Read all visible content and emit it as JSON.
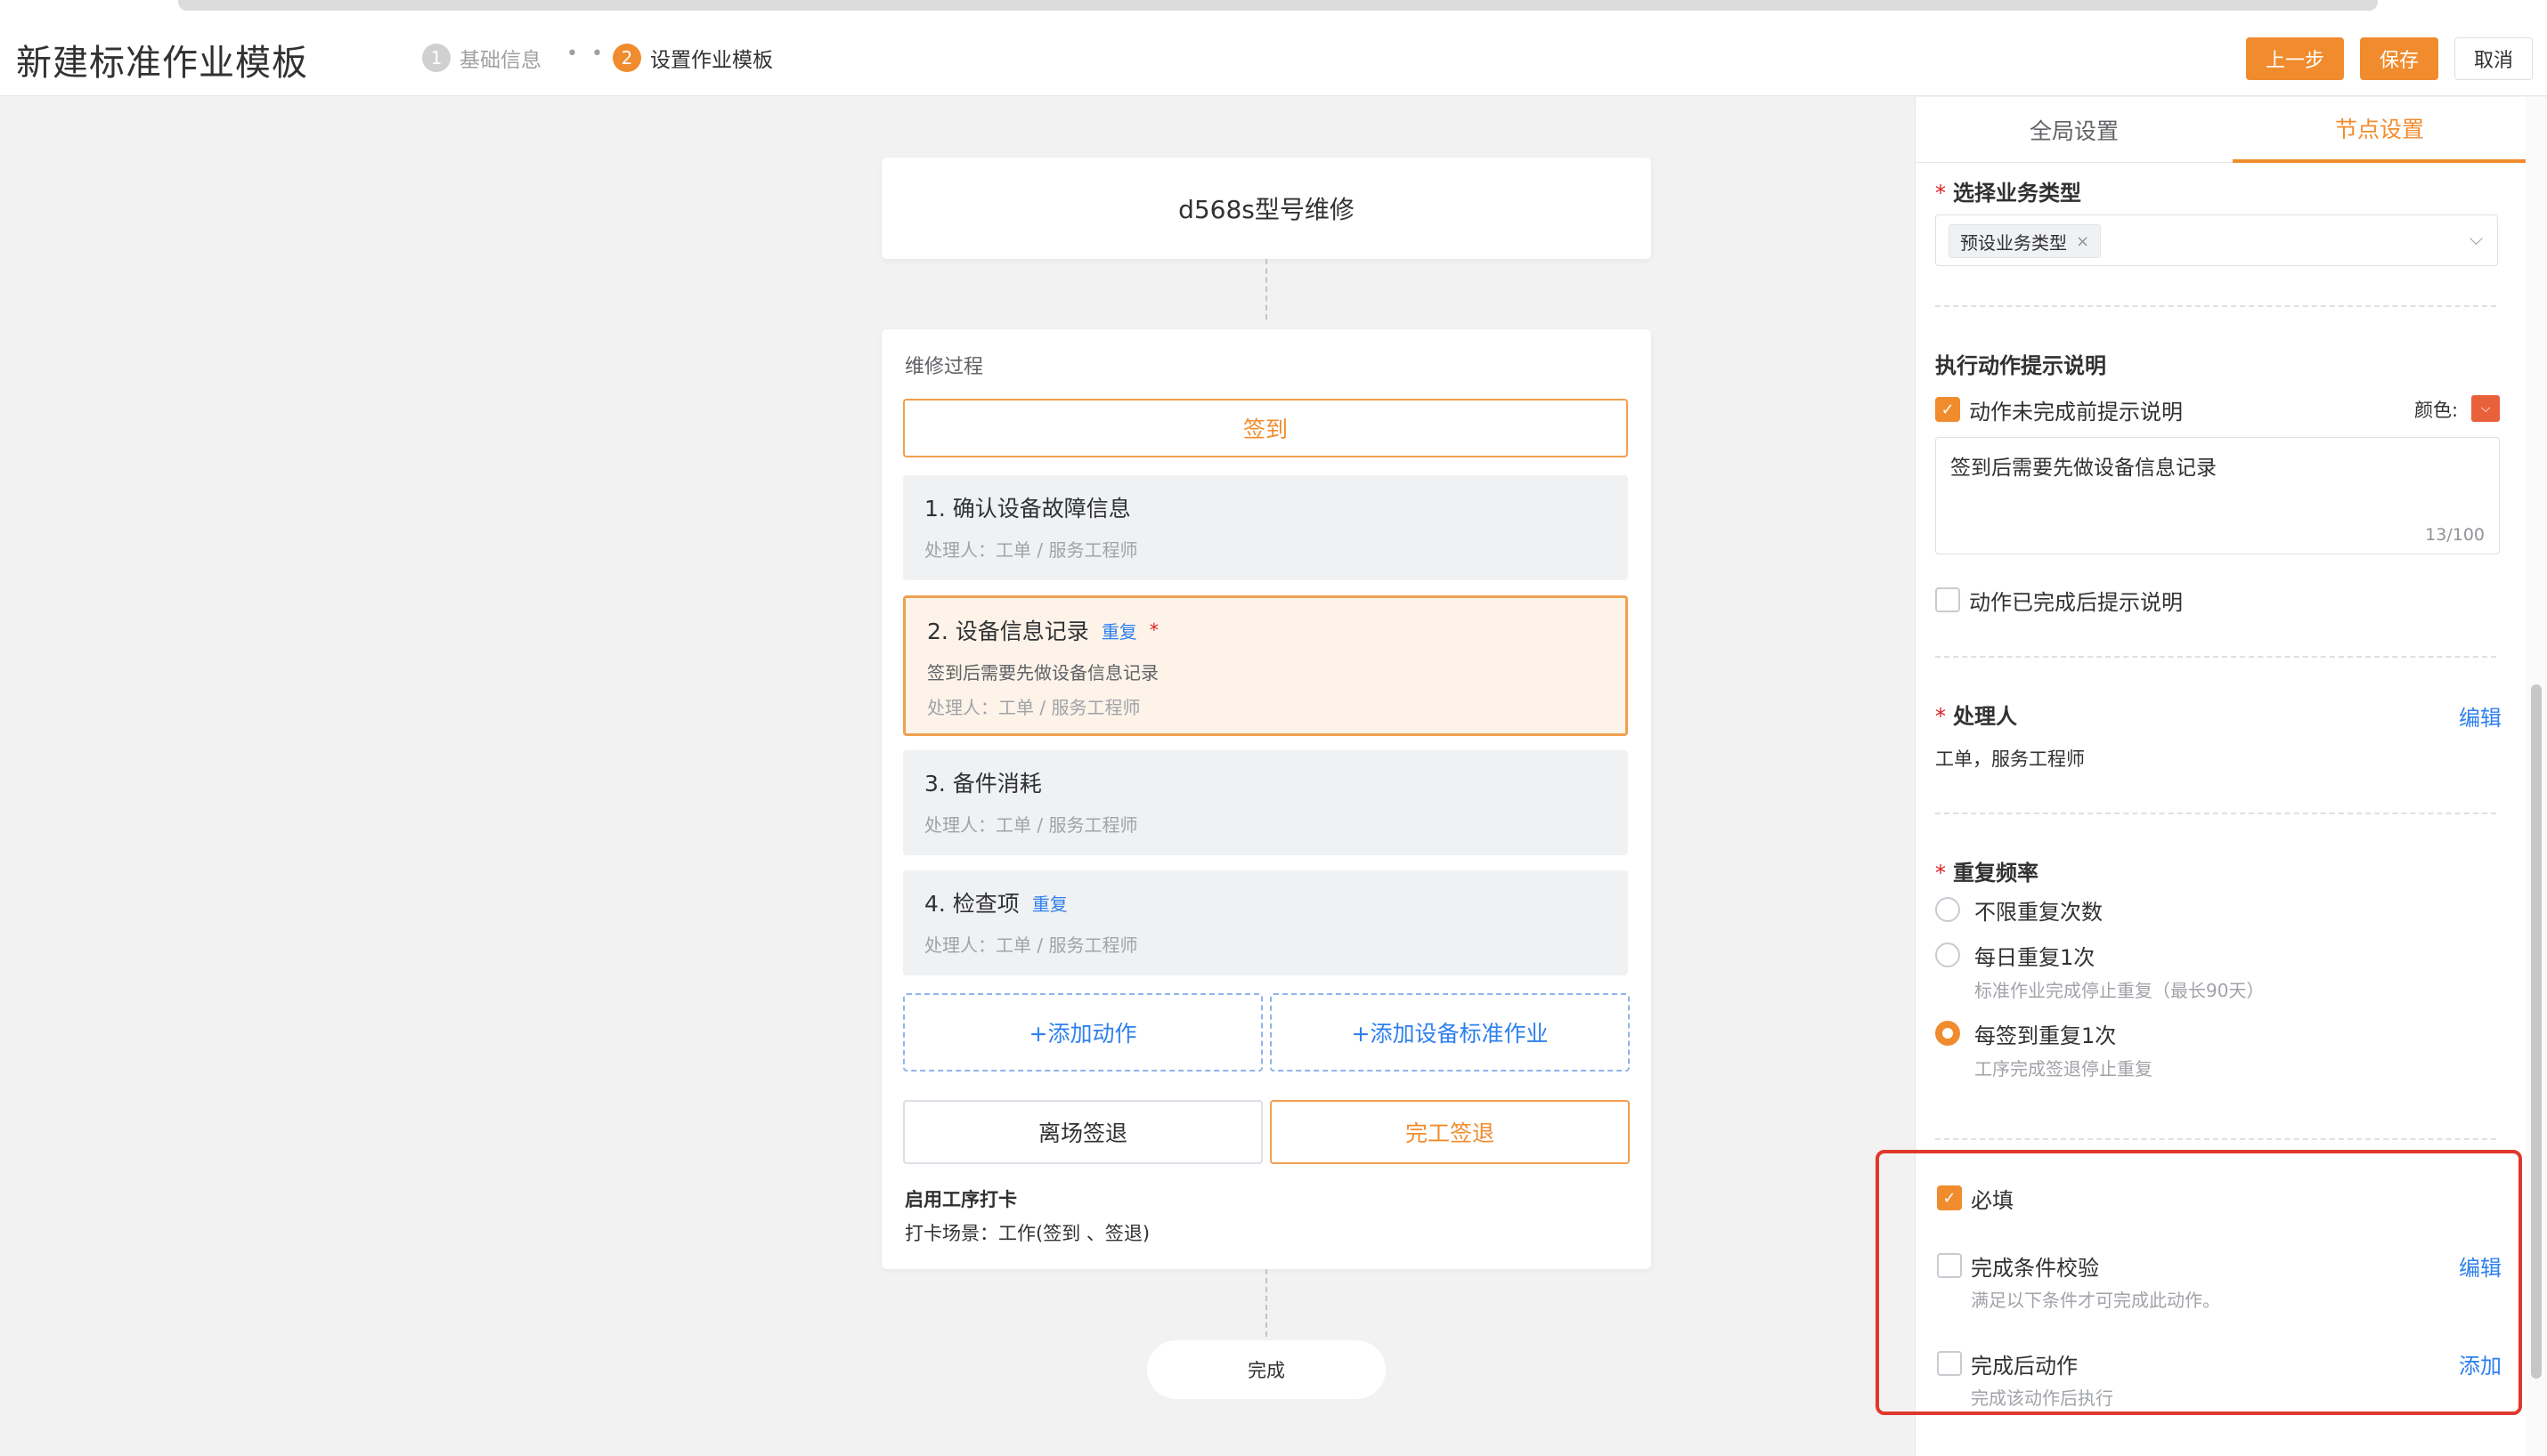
{
  "header": {
    "title": "新建标准作业模板",
    "steps": [
      {
        "num": "1",
        "label": "基础信息"
      },
      {
        "num": "2",
        "label": "设置作业模板"
      }
    ],
    "step_sep": "• •",
    "prev_label": "上一步",
    "save_label": "保存",
    "cancel_label": "取消"
  },
  "canvas": {
    "template_name": "d568s型号维修",
    "process_label": "维修过程",
    "checkin_label": "签到",
    "actions": [
      {
        "title": "1. 确认设备故障信息",
        "handler": "处理人：工单 / 服务工程师"
      },
      {
        "title": "2. 设备信息记录",
        "repeat": "重复",
        "required": "*",
        "desc": "签到后需要先做设备信息记录",
        "handler": "处理人：工单 / 服务工程师"
      },
      {
        "title": "3. 备件消耗",
        "handler": "处理人：工单 / 服务工程师"
      },
      {
        "title": "4. 检查项",
        "repeat": "重复",
        "handler": "处理人：工单 / 服务工程师"
      }
    ],
    "add_action": "+添加动作",
    "add_std": "+添加设备标准作业",
    "leave_checkout": "离场签退",
    "finish_checkout": "完工签退",
    "clock_title": "启用工序打卡",
    "clock_scene": "打卡场景：工作(签到 、签退)",
    "done_label": "完成"
  },
  "panel": {
    "tabs": [
      "全局设置",
      "节点设置"
    ],
    "biz_type_label": "选择业务类型",
    "biz_type_tag": "预设业务类型",
    "tag_close": "×",
    "select_chevron": "⌵",
    "tip_section": "执行动作提示说明",
    "tip_before_label": "动作未完成前提示说明",
    "color_label": "颜色:",
    "color_value": "#e8613b",
    "tip_before_text": "签到后需要先做设备信息记录",
    "tip_count": "13/100",
    "tip_after_label": "动作已完成后提示说明",
    "handler_label": "处理人",
    "handler_edit": "编辑",
    "handler_value": "工单，服务工程师",
    "repeat_label": "重复频率",
    "repeat_options": [
      {
        "label": "不限重复次数",
        "sub": ""
      },
      {
        "label": "每日重复1次",
        "sub": "标准作业完成停止重复（最长90天）"
      },
      {
        "label": "每签到重复1次",
        "sub": "工序完成签退停止重复"
      }
    ],
    "required_label": "必填",
    "cond_label": "完成条件校验",
    "cond_edit": "编辑",
    "cond_sub": "满足以下条件才可完成此动作。",
    "after_label": "完成后动作",
    "after_add": "添加",
    "after_sub": "完成该动作后执行"
  },
  "accent_color": "#f08c2e",
  "link_color": "#2f80ed"
}
